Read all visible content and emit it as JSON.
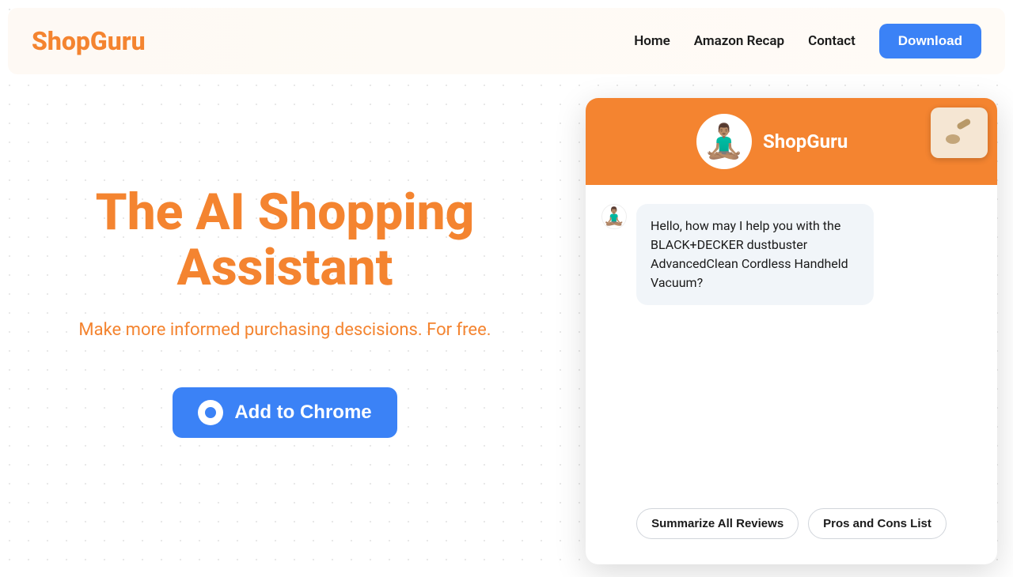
{
  "navbar": {
    "logo": "ShopGuru",
    "links": [
      "Home",
      "Amazon Recap",
      "Contact"
    ],
    "download_label": "Download"
  },
  "hero": {
    "title": "The AI Shopping Assistant",
    "subtitle": "Make more informed purchasing descisions. For free.",
    "cta_label": "Add to Chrome"
  },
  "chat": {
    "title": "ShopGuru",
    "message": "Hello, how may I help you with the BLACK+DECKER dustbuster AdvancedClean Cordless Handheld Vacuum?",
    "suggestions": [
      "Summarize All Reviews",
      "Pros and Cons List"
    ]
  }
}
